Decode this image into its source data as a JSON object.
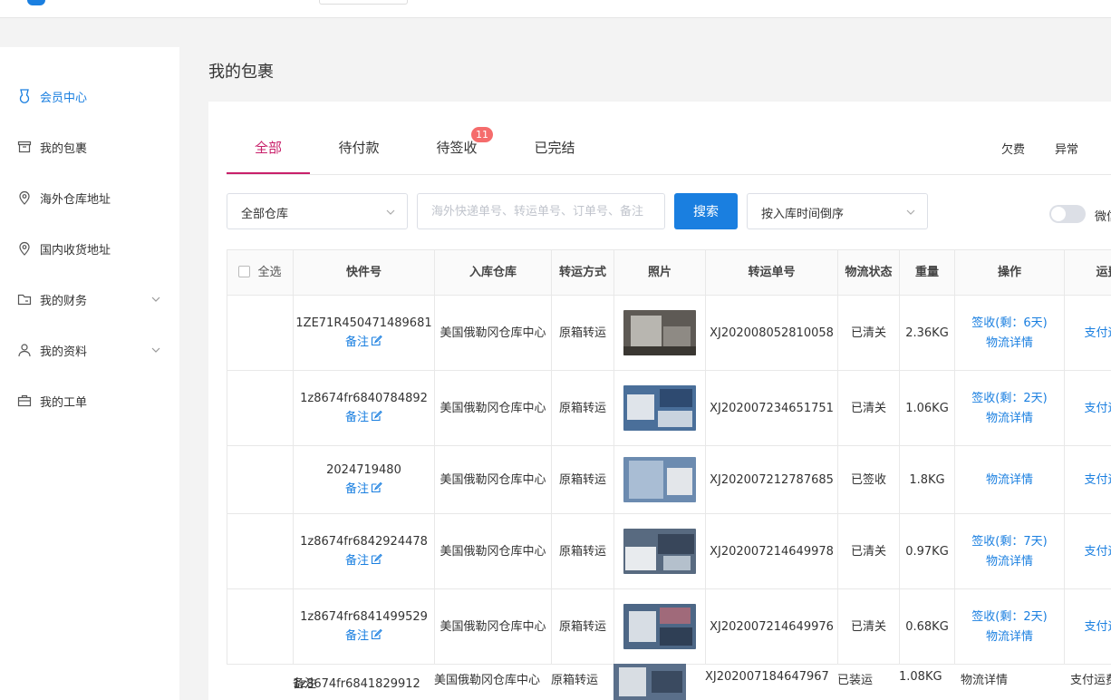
{
  "sidebar": {
    "items": [
      {
        "label": "会员中心"
      },
      {
        "label": "我的包裹"
      },
      {
        "label": "海外仓库地址"
      },
      {
        "label": "国内收货地址"
      },
      {
        "label": "我的财务"
      },
      {
        "label": "我的资料"
      },
      {
        "label": "我的工单"
      }
    ]
  },
  "page_title": "我的包裹",
  "tabs": [
    {
      "label": "全部"
    },
    {
      "label": "待付款"
    },
    {
      "label": "待签收",
      "badge": "11"
    },
    {
      "label": "已完结"
    }
  ],
  "right_links": [
    "欠费",
    "异常"
  ],
  "filters": {
    "warehouse": "全部仓库",
    "search_placeholder": "海外快递单号、转运单号、订单号、备注",
    "search_button": "搜索",
    "sort": "按入库时间倒序",
    "toggle_label": "微信"
  },
  "table": {
    "select_all": "全选",
    "headers": [
      "快件号",
      "入库仓库",
      "转运方式",
      "照片",
      "转运单号",
      "物流状态",
      "重量",
      "操作",
      "运费"
    ],
    "note_label": "备注",
    "rows": [
      {
        "tracking": "1ZE71R450471489681",
        "warehouse": "美国俄勒冈仓库中心",
        "method": "原箱转运",
        "transfer_no": "XJ202008052810058",
        "status": "已清关",
        "weight": "2.36KG",
        "sign": "签收(剩：6天)",
        "logistics": "物流详情",
        "pay": "支付运费"
      },
      {
        "tracking": "1z8674fr6840784892",
        "warehouse": "美国俄勒冈仓库中心",
        "method": "原箱转运",
        "transfer_no": "XJ202007234651751",
        "status": "已清关",
        "weight": "1.06KG",
        "sign": "签收(剩：2天)",
        "logistics": "物流详情",
        "pay": "支付运费"
      },
      {
        "tracking": "2024719480",
        "warehouse": "美国俄勒冈仓库中心",
        "method": "原箱转运",
        "transfer_no": "XJ202007212787685",
        "status": "已签收",
        "weight": "1.8KG",
        "sign": "",
        "logistics": "物流详情",
        "pay": "支付运费"
      },
      {
        "tracking": "1z8674fr6842924478",
        "warehouse": "美国俄勒冈仓库中心",
        "method": "原箱转运",
        "transfer_no": "XJ202007214649978",
        "status": "已清关",
        "weight": "0.97KG",
        "sign": "签收(剩：7天)",
        "logistics": "物流详情",
        "pay": "支付运费"
      },
      {
        "tracking": "1z8674fr6841499529",
        "warehouse": "美国俄勒冈仓库中心",
        "method": "原箱转运",
        "transfer_no": "XJ202007214649976",
        "status": "已清关",
        "weight": "0.68KG",
        "sign": "签收(剩：2天)",
        "logistics": "物流详情",
        "pay": "支付运费"
      }
    ],
    "last_row": {
      "tracking": "1z8674fr6841829912",
      "note": "备注",
      "warehouse": "美国俄勒冈仓库中心",
      "method": "原箱转运",
      "transfer_no": "XJ202007184647967",
      "status": "已装运",
      "weight": "1.08KG",
      "logistics": "物流详情",
      "pay": "支付运费"
    }
  },
  "colors": {
    "accent": "#1a7fe0",
    "tab_active": "#c8206a",
    "badge": "#f56c6c"
  }
}
